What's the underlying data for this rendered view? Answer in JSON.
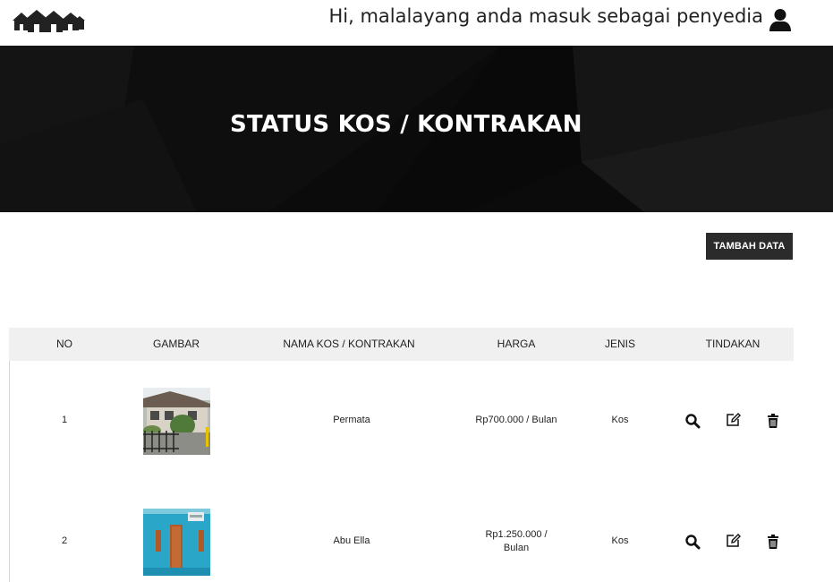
{
  "header": {
    "greeting": "Hi, malalayang anda masuk sebagai penyedia"
  },
  "hero": {
    "title": "STATUS KOS / KONTRAKAN"
  },
  "toolbar": {
    "add_label": "TAMBAH DATA"
  },
  "table": {
    "columns": [
      "NO",
      "GAMBAR",
      "NAMA KOS / KONTRAKAN",
      "HARGA",
      "JENIS",
      "TINDAKAN"
    ],
    "rows": [
      {
        "no": "1",
        "name": "Permata",
        "price": "Rp700.000 / Bulan",
        "type": "Kos"
      },
      {
        "no": "2",
        "name": "Abu Ella",
        "price_line1": "Rp1.250.000 /",
        "price_line2": "Bulan",
        "type": "Kos"
      }
    ]
  },
  "icons": {
    "logo": "houses-logo-icon",
    "user": "user-icon",
    "view": "search-icon",
    "edit": "edit-icon",
    "delete": "trash-icon"
  },
  "colors": {
    "hero_bg": "#0a0a0a",
    "button_bg": "#2b2b2b",
    "header_bg": "#f0f0f0"
  }
}
